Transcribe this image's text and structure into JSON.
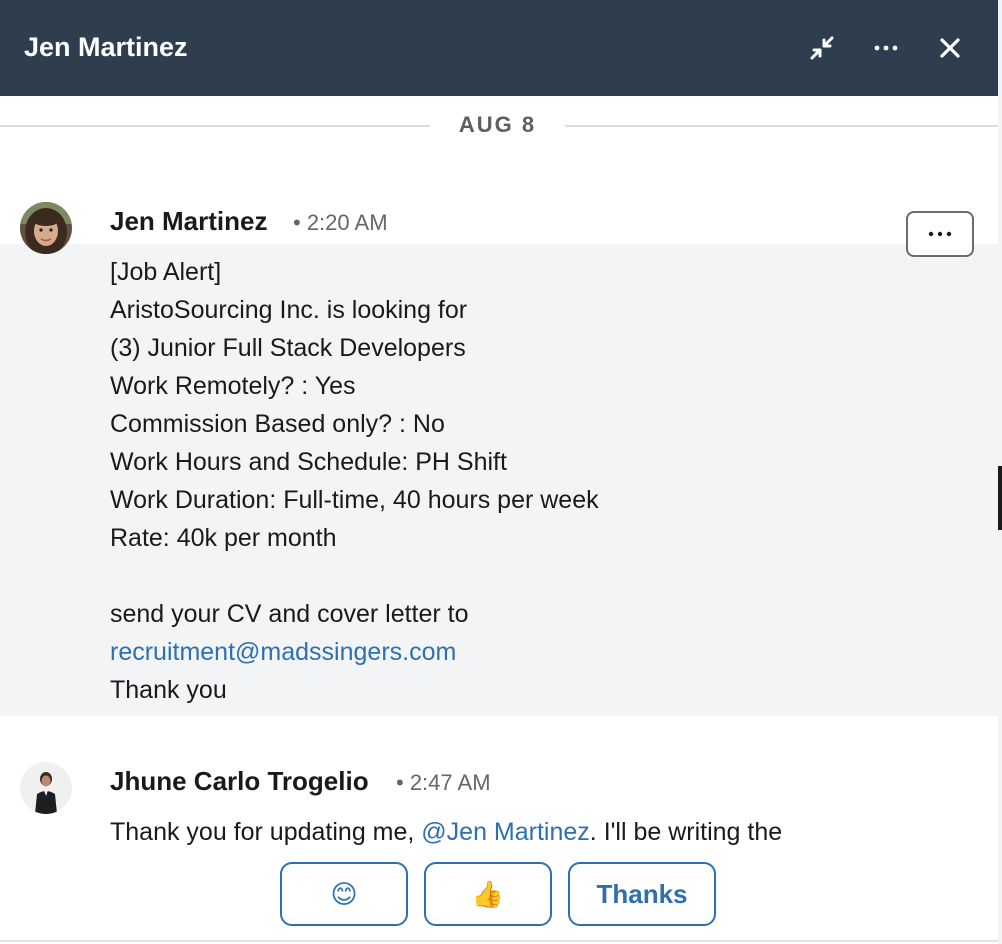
{
  "header": {
    "title": "Jen Martinez",
    "icons": [
      "minimize-icon",
      "more-icon",
      "close-icon"
    ],
    "background": "#2e3e4f"
  },
  "conversation": {
    "date_divider": "AUG 8",
    "messages": [
      {
        "sender": "Jen Martinez",
        "meta": "• 2:20 AM",
        "lines": [
          "[Job Alert]",
          "AristoSourcing Inc. is looking for",
          "(3) Junior Full Stack Developers",
          "Work Remotely? : Yes",
          "Commission Based only? : No",
          "Work Hours and Schedule: PH Shift",
          "Work Duration: Full-time, 40 hours per week",
          "Rate: 40k per month",
          "",
          "send your CV and cover letter to"
        ],
        "email": "recruitment@madssingers.com",
        "closing": "Thank you"
      },
      {
        "sender": "Jhune Carlo Trogelio",
        "meta": "• 2:47 AM",
        "text_before": "Thank you for updating me, ",
        "mention": "@Jen Martinez",
        "text_after": ". I'll be writing the"
      }
    ]
  },
  "quick_replies": {
    "smile": "😊",
    "thumbs_up": "👍",
    "thanks": "Thanks"
  },
  "colors": {
    "accent": "#2e6fb0",
    "highlight": "#f3f4f5"
  }
}
